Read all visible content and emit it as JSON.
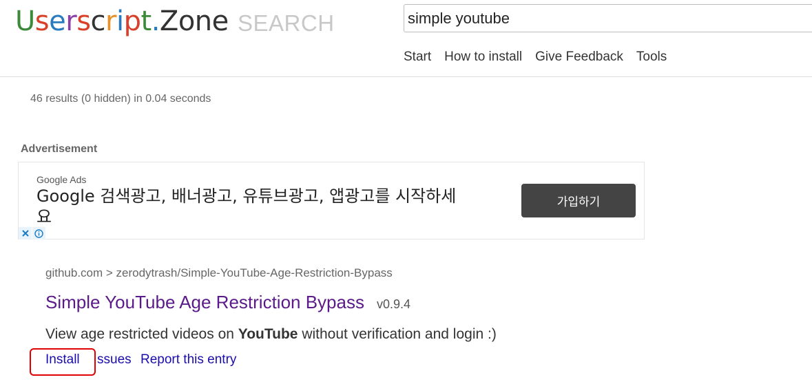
{
  "logo": {
    "letters": [
      {
        "ch": "U",
        "color": "#3a8a3a"
      },
      {
        "ch": "s",
        "color": "#d9402a"
      },
      {
        "ch": "e",
        "color": "#2a7abf"
      },
      {
        "ch": "r",
        "color": "#8b3fa8"
      },
      {
        "ch": "s",
        "color": "#d9402a"
      },
      {
        "ch": "c",
        "color": "#333333"
      },
      {
        "ch": "r",
        "color": "#e8902a"
      },
      {
        "ch": "i",
        "color": "#2a7abf"
      },
      {
        "ch": "p",
        "color": "#d9402a"
      },
      {
        "ch": "t",
        "color": "#3a8a3a"
      },
      {
        "ch": ".",
        "color": "#2a7abf"
      },
      {
        "ch": "Z",
        "color": "#333333"
      },
      {
        "ch": "o",
        "color": "#333333"
      },
      {
        "ch": "n",
        "color": "#333333"
      },
      {
        "ch": "e",
        "color": "#333333"
      }
    ],
    "search_label": "SEARCH"
  },
  "search": {
    "value": "simple youtube"
  },
  "nav": {
    "items": [
      "Start",
      "How to install",
      "Give Feedback",
      "Tools"
    ]
  },
  "stats": {
    "text": "46 results (0 hidden) in 0.04 seconds"
  },
  "ad": {
    "label": "Advertisement",
    "source": "Google Ads",
    "headline": "Google 검색광고, 배너광고, 유튜브광고, 앱광고를 시작하세요",
    "button_label": "가입하기"
  },
  "result": {
    "url": "github.com > zerodytrash/Simple-YouTube-Age-Restriction-Bypass",
    "title": "Simple YouTube Age Restriction Bypass",
    "version": "v0.9.4",
    "desc_before": "View age restricted videos on ",
    "desc_bold": "YouTube",
    "desc_after": " without verification and login :)",
    "install_label": "Install",
    "issues_label": "ssues",
    "report_label": "Report this entry"
  },
  "colors": {
    "title": "#5b1a8a",
    "link": "#1a0dab",
    "highlight": "#e00000",
    "ad_button": "#444444"
  }
}
